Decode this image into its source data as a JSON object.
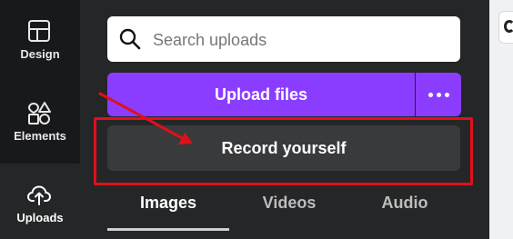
{
  "sidebar": {
    "items": [
      {
        "label": "Design",
        "icon": "layout-icon"
      },
      {
        "label": "Elements",
        "icon": "shapes-icon"
      },
      {
        "label": "Uploads",
        "icon": "cloud-upload-icon",
        "active": true
      }
    ]
  },
  "search": {
    "placeholder": "Search uploads",
    "icon": "search-icon"
  },
  "upload_button": {
    "label": "Upload files",
    "color": "#8b3dff",
    "more_icon": "ellipsis-icon"
  },
  "record_button": {
    "label": "Record yourself"
  },
  "tabs": [
    {
      "label": "Images",
      "active": true
    },
    {
      "label": "Videos"
    },
    {
      "label": "Audio"
    }
  ],
  "annotation": {
    "color": "#e0101b"
  }
}
